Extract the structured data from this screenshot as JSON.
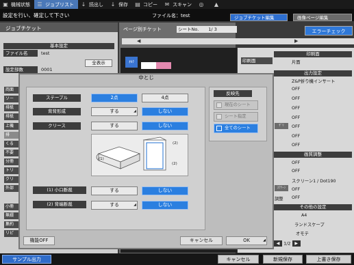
{
  "topbar": {
    "items": [
      {
        "label": "機械状態",
        "icon": "machine-status-icon"
      },
      {
        "label": "ジョブリスト",
        "icon": "job-list-icon"
      },
      {
        "label": "読出し",
        "icon": "read-icon"
      },
      {
        "label": "保存",
        "icon": "save-icon"
      },
      {
        "label": "コピー",
        "icon": "copy-icon"
      },
      {
        "label": "スキャン",
        "icon": "scan-icon"
      }
    ]
  },
  "header": {
    "message": "設定を行い、確定して下さい",
    "filename": "ファイル名：test",
    "tab_job_ticket_edit": "ジョブチケット編集",
    "tab_image_page_edit": "画像ページ編集"
  },
  "left": {
    "title": "ジョブチケット",
    "basic_settings": "基本設定",
    "filename_label": "ファイル名",
    "filename_value": "test",
    "show_all": "全表示",
    "settings_label": "設定部数",
    "settings_value": "0001",
    "truncated": [
      "両面",
      "ソー",
      "排紙",
      "排紙",
      "上機",
      "排",
      "くる",
      "不要",
      "分冊",
      "トリ",
      "クリ",
      "外部",
      "小冊",
      "無綴",
      "集約",
      "リピ"
    ]
  },
  "middle": {
    "page_ticket": "ページ別チケット",
    "sheet_no_label": "シートNo.",
    "sheet_no_value": "1/   3",
    "thumb_tag": "ｵｶｸ"
  },
  "right": {
    "error_check": "エラーチェック",
    "print_side_title": "印刷面",
    "print_side_label": "印刷面",
    "print_side_value": "片面",
    "output_settings_title": "出力設定",
    "output_rows": [
      "Z&P折り機インサート",
      "OFF",
      "OFF",
      "OFF",
      "OFF",
      "OFF",
      "OFF",
      "OFF"
    ],
    "tags": [
      "ｻﾞﾘ",
      "ｽｸﾘｰﾝ"
    ],
    "image_adjust_title": "画質調整",
    "image_rows": [
      "OFF",
      "OFF",
      "スクリーン1 / Dot190",
      "OFF",
      "OFF"
    ],
    "adjust_label": "調整",
    "other_title": "その他の設定",
    "other_rows": [
      "A4",
      "ランドスケープ",
      "オモテ"
    ],
    "page_indicator": "1/2"
  },
  "bottom": {
    "sample_output": "サンプル出力",
    "cancel": "キャンセル",
    "new_save": "新規保存",
    "overwrite_save": "上書き保存"
  },
  "dialog": {
    "title": "中とじ",
    "staple_label": "ステープル",
    "staple_opt1": "2点",
    "staple_opt2": "4点",
    "spine_label": "背背形成",
    "spine_on": "する",
    "spine_off": "しない",
    "crease_label": "クリース",
    "crease_on": "する",
    "crease_off": "しない",
    "illus_label1": "(1)",
    "illus_label2": "(2)",
    "illus_label3": "(2)",
    "trim1_label": "(1) 小口断裁",
    "trim1_on": "する",
    "trim1_off": "しない",
    "trim2_label": "(2) 背端断裁",
    "trim2_on": "する",
    "trim2_off": "しない",
    "reflect_title": "反映先",
    "reflect_current": "現在のシート",
    "reflect_sheet": "シート指定",
    "reflect_all": "全てのシート",
    "function_off": "機能OFF",
    "cancel": "キャンセル",
    "ok": "OK"
  },
  "colors": {
    "accent": "#2b7fe0",
    "topbar_bg": "#1a1a1a",
    "panel_bg": "#cfcfcf",
    "dialog_bg": "#bdbdbd",
    "dark_label": "#3d3d3d"
  }
}
